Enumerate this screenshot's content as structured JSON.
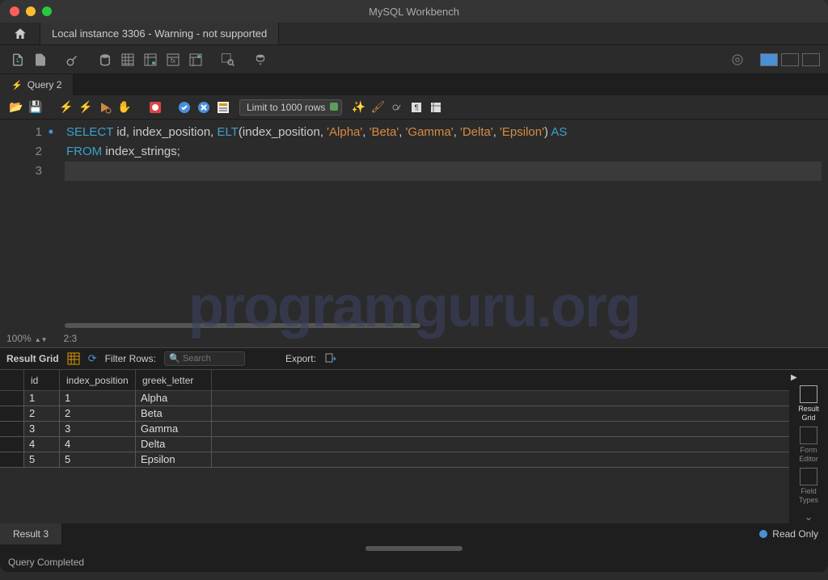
{
  "title": "MySQL Workbench",
  "connection_tab": "Local instance 3306 - Warning - not supported",
  "query_tab": "Query 2",
  "limit_dropdown": "Limit to 1000 rows",
  "zoom": "100%",
  "cursor_pos": "2:3",
  "result_bar": {
    "label": "Result Grid",
    "filter_label": "Filter Rows:",
    "search_placeholder": "Search",
    "export_label": "Export:"
  },
  "sql": {
    "line1": {
      "k1": "SELECT",
      "t1": " id, index_position, ",
      "fn": "ELT",
      "t2": "(index_position, ",
      "s1": "'Alpha'",
      "c1": ", ",
      "s2": "'Beta'",
      "c2": ", ",
      "s3": "'Gamma'",
      "c3": ", ",
      "s4": "'Delta'",
      "c4": ", ",
      "s5": "'Epsilon'",
      "t3": ") ",
      "k2": "AS"
    },
    "line2": {
      "k1": "FROM",
      "t1": " index_strings;"
    }
  },
  "gutter": [
    "1",
    "2",
    "3"
  ],
  "columns": [
    "id",
    "index_position",
    "greek_letter"
  ],
  "rows": [
    {
      "id": "1",
      "index_position": "1",
      "greek_letter": "Alpha"
    },
    {
      "id": "2",
      "index_position": "2",
      "greek_letter": "Beta"
    },
    {
      "id": "3",
      "index_position": "3",
      "greek_letter": "Gamma"
    },
    {
      "id": "4",
      "index_position": "4",
      "greek_letter": "Delta"
    },
    {
      "id": "5",
      "index_position": "5",
      "greek_letter": "Epsilon"
    }
  ],
  "side_panel": [
    "Result Grid",
    "Form Editor",
    "Field Types"
  ],
  "bottom_tab": "Result 3",
  "read_only": "Read Only",
  "status": "Query Completed",
  "watermark": "programguru.org"
}
